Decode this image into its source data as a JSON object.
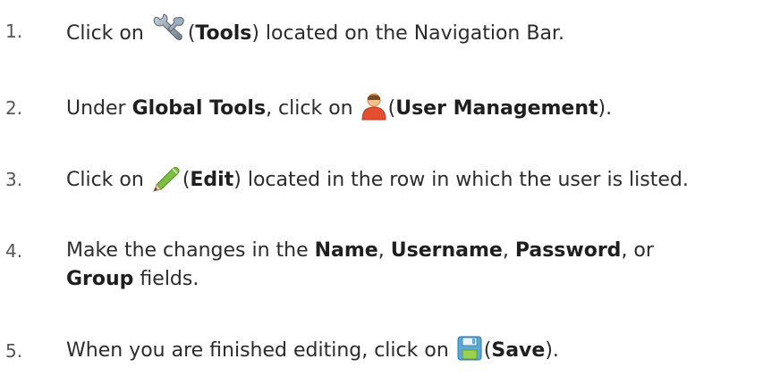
{
  "steps": [
    {
      "number": "1.",
      "parts": [
        "Click on ",
        "(",
        "Tools",
        ") located on the Navigation Bar."
      ],
      "icon": "wrench-icon"
    },
    {
      "number": "2.",
      "parts": [
        "Under ",
        "Global Tools",
        ", click on ",
        "(",
        "User Management",
        ")."
      ],
      "icon": "user-icon"
    },
    {
      "number": "3.",
      "parts": [
        "Click on ",
        "(",
        "Edit",
        ") located in the row in which the user is listed."
      ],
      "icon": "pencil-icon"
    },
    {
      "number": "4.",
      "line1_parts": [
        "Make the changes in the ",
        "Name",
        ", ",
        "Username",
        ", ",
        "Password",
        ", or"
      ],
      "line2_parts": [
        "Group",
        " fields."
      ]
    },
    {
      "number": "5.",
      "parts": [
        "When you are finished editing, click on ",
        "(",
        "Save",
        ")."
      ],
      "icon": "save-icon"
    }
  ]
}
